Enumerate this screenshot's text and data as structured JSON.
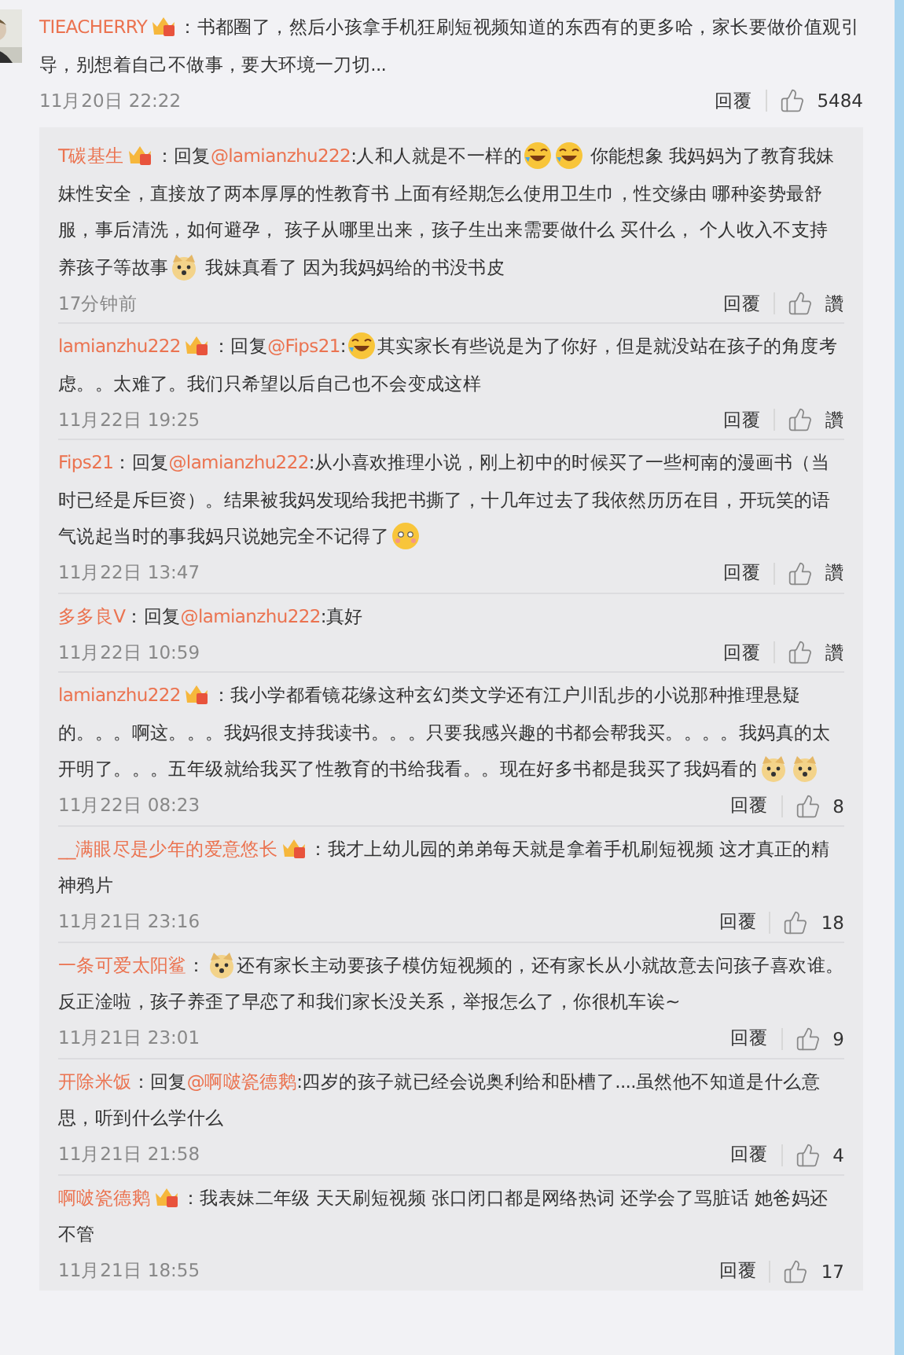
{
  "comment": {
    "user": "TIEACHERRY",
    "badge": true,
    "prefix": "：",
    "parts": [
      {
        "kind": "text",
        "text": "书都圈了，然后小孩拿手机狂刷短视频知道的东西有的更多哈，家长要做价值观引导，别想着自己不做事，要大环境一刀切..."
      }
    ],
    "time": "11月20日 22:22",
    "reply_label": "回覆",
    "likes": "5484"
  },
  "replies": [
    {
      "user": "T碳基生",
      "badge": true,
      "prefix": "：回复",
      "mention": "@lamianzhu222",
      "parts": [
        {
          "kind": "text",
          "text": ":人和人就是不一样的"
        },
        {
          "kind": "lol"
        },
        {
          "kind": "lol"
        },
        {
          "kind": "text",
          "text": " 你能想象 我妈妈为了教育我妹妹性安全，直接放了两本厚厚的性教育书 上面有经期怎么使用卫生巾，性交缘由 哪种姿势最舒服，事后清洗，如何避孕， 孩子从哪里出来，孩子生出来需要做什么 买什么， 个人收入不支持养孩子等故事"
        },
        {
          "kind": "doge"
        },
        {
          "kind": "text",
          "text": " 我妹真看了 因为我妈妈给的书没书皮"
        }
      ],
      "time": "17分钟前",
      "reply_label": "回覆",
      "likes": "讚"
    },
    {
      "user": "lamianzhu222",
      "badge": true,
      "prefix": "：回复",
      "mention": "@Fips21",
      "parts": [
        {
          "kind": "text",
          "text": ":"
        },
        {
          "kind": "lol"
        },
        {
          "kind": "text",
          "text": "其实家长有些说是为了你好，但是就没站在孩子的角度考虑。。太难了。我们只希望以后自己也不会变成这样"
        }
      ],
      "time": "11月22日 19:25",
      "reply_label": "回覆",
      "likes": "讚"
    },
    {
      "user": "Fips21",
      "badge": false,
      "prefix": "：回复",
      "mention": "@lamianzhu222",
      "parts": [
        {
          "kind": "text",
          "text": ":从小喜欢推理小说，刚上初中的时候买了一些柯南的漫画书（当时已经是斥巨资）。结果被我妈发现给我把书撕了，十几年过去了我依然历历在目，开玩笑的语气说起当时的事我妈只说她完全不记得了"
        },
        {
          "kind": "blush"
        }
      ],
      "time": "11月22日 13:47",
      "reply_label": "回覆",
      "likes": "讚"
    },
    {
      "user": "多多良V",
      "badge": false,
      "prefix": "：回复",
      "mention": "@lamianzhu222",
      "parts": [
        {
          "kind": "text",
          "text": ":真好"
        }
      ],
      "time": "11月22日 10:59",
      "reply_label": "回覆",
      "likes": "讚"
    },
    {
      "user": "lamianzhu222",
      "badge": true,
      "prefix": "：",
      "parts": [
        {
          "kind": "text",
          "text": "我小学都看镜花缘这种玄幻类文学还有江户川乱步的小说那种推理悬疑的。。。啊这。。。我妈很支持我读书。。。只要我感兴趣的书都会帮我买。。。。我妈真的太开明了。。。五年级就给我买了性教育的书给我看。。现在好多书都是我买了我妈看的"
        },
        {
          "kind": "doge"
        },
        {
          "kind": "doge"
        }
      ],
      "time": "11月22日 08:23",
      "reply_label": "回覆",
      "likes": "8"
    },
    {
      "user": "__满眼尽是少年的爱意悠长",
      "badge": true,
      "prefix": "：",
      "parts": [
        {
          "kind": "text",
          "text": "我才上幼儿园的弟弟每天就是拿着手机刷短视频 这才真正的精神鸦片"
        }
      ],
      "time": "11月21日 23:16",
      "reply_label": "回覆",
      "likes": "18"
    },
    {
      "user": "一条可爱太阳鲨",
      "badge": false,
      "prefix": "：",
      "parts": [
        {
          "kind": "doge"
        },
        {
          "kind": "text",
          "text": "还有家长主动要孩子模仿短视频的，还有家长从小就故意去问孩子喜欢谁。反正淦啦，孩子养歪了早恋了和我们家长没关系，举报怎么了，你很机车诶~"
        }
      ],
      "time": "11月21日 23:01",
      "reply_label": "回覆",
      "likes": "9"
    },
    {
      "user": "开除米饭",
      "badge": false,
      "prefix": "：回复",
      "mention": "@啊啵瓷德鹅",
      "parts": [
        {
          "kind": "text",
          "text": ":四岁的孩子就已经会说奥利给和卧槽了....虽然他不知道是什么意思，听到什么学什么"
        }
      ],
      "time": "11月21日 21:58",
      "reply_label": "回覆",
      "likes": "4"
    },
    {
      "user": "啊啵瓷德鹅",
      "badge": true,
      "prefix": "：",
      "parts": [
        {
          "kind": "text",
          "text": "我表妹二年级 天天刷短视频 张口闭口都是网络热词 还学会了骂脏话 她爸妈还不管"
        }
      ],
      "time": "11月21日 18:55",
      "reply_label": "回覆",
      "likes": "17"
    }
  ]
}
